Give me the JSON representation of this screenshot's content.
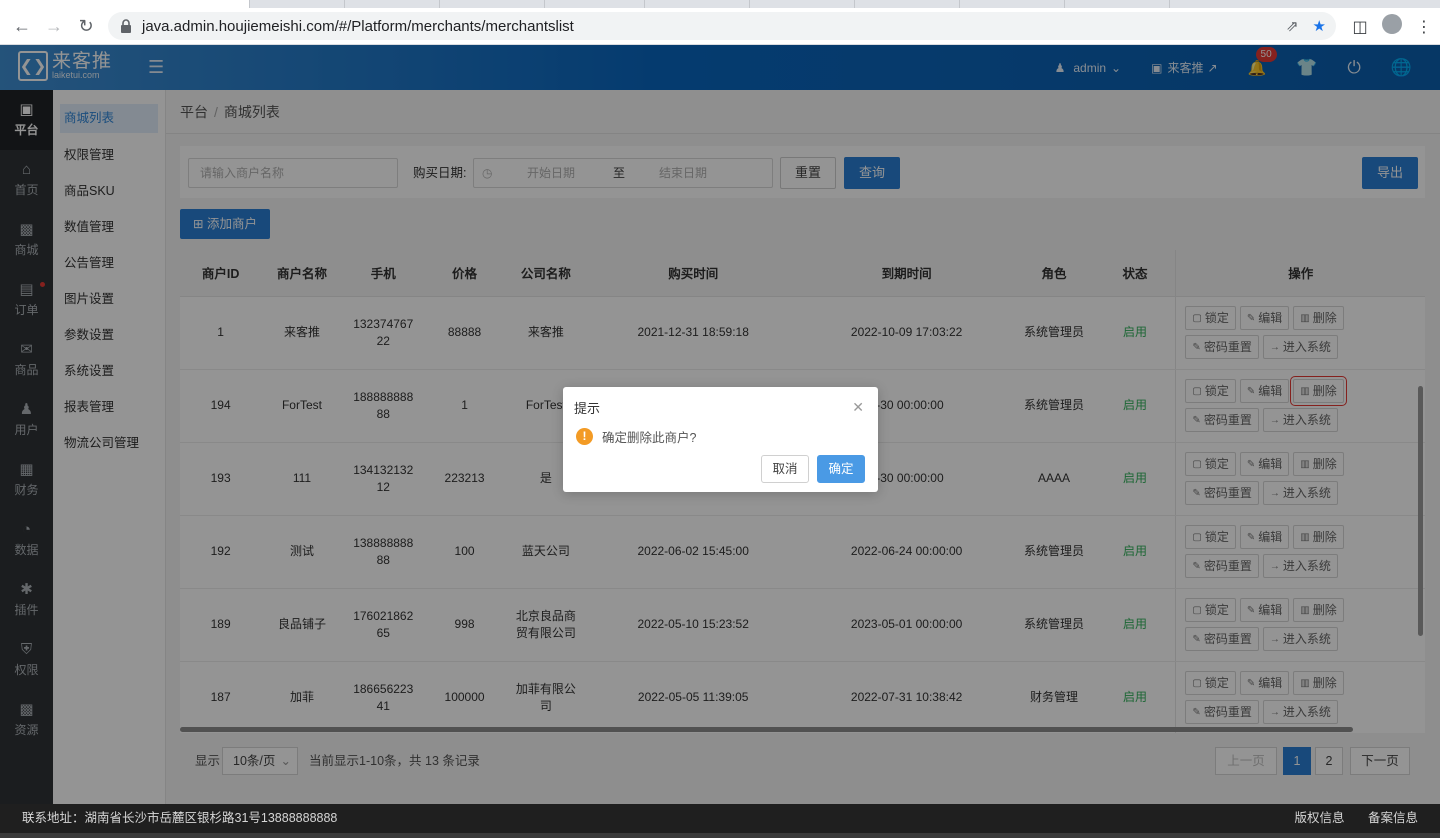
{
  "browser": {
    "url": "java.admin.houjiemeishi.com/#/Platform/merchants/merchantslist"
  },
  "header": {
    "logo_cn": "来客推",
    "logo_en": "laiketui.com",
    "user": "admin",
    "store": "来客推",
    "notification_count": "50"
  },
  "rail": {
    "items": [
      {
        "label": "平台",
        "icon": "platform-icon"
      },
      {
        "label": "首页",
        "icon": "home-icon"
      },
      {
        "label": "商城",
        "icon": "mall-icon"
      },
      {
        "label": "订单",
        "icon": "order-icon"
      },
      {
        "label": "商品",
        "icon": "goods-icon"
      },
      {
        "label": "用户",
        "icon": "user-icon"
      },
      {
        "label": "财务",
        "icon": "wallet-icon"
      },
      {
        "label": "数据",
        "icon": "pie-chart-icon"
      },
      {
        "label": "插件",
        "icon": "puzzle-icon"
      },
      {
        "label": "权限",
        "icon": "shield-icon"
      },
      {
        "label": "资源",
        "icon": "image-icon"
      }
    ]
  },
  "submenu": {
    "items": [
      "商城列表",
      "权限管理",
      "商品SKU",
      "数值管理",
      "公告管理",
      "图片设置",
      "参数设置",
      "系统设置",
      "报表管理",
      "物流公司管理"
    ]
  },
  "breadcrumb": {
    "root": "平台",
    "sep": "/",
    "current": "商城列表"
  },
  "filters": {
    "name_placeholder": "请输入商户名称",
    "date_label": "购买日期:",
    "start_placeholder": "开始日期",
    "to": "至",
    "end_placeholder": "结束日期",
    "reset": "重置",
    "query": "查询",
    "export": "导出"
  },
  "add_button": "添加商户",
  "table": {
    "headers": [
      "商户ID",
      "商户名称",
      "手机",
      "价格",
      "公司名称",
      "购买时间",
      "到期时间",
      "角色",
      "状态",
      "操作"
    ],
    "ops": {
      "lock": "锁定",
      "edit": "编辑",
      "delete": "删除",
      "reset_pwd": "密码重置",
      "enter": "进入系统"
    },
    "rows": [
      {
        "id": "1",
        "name": "来客推",
        "phone1": "132374767",
        "phone2": "22",
        "price": "88888",
        "company1": "来客推",
        "company2": "",
        "buy": "2021-12-31 18:59:18",
        "expire": "2022-10-09 17:03:22",
        "role": "系统管理员",
        "status": "启用"
      },
      {
        "id": "194",
        "name": "ForTest",
        "phone1": "188888888",
        "phone2": "88",
        "price": "1",
        "company1": "ForTest",
        "company2": "",
        "buy": "",
        "expire": "6-30 00:00:00",
        "role": "系统管理员",
        "status": "启用"
      },
      {
        "id": "193",
        "name": "111",
        "phone1": "134132132",
        "phone2": "12",
        "price": "223213",
        "company1": "是",
        "company2": "",
        "buy": "",
        "expire": "6-30 00:00:00",
        "role": "AAAA",
        "status": "启用"
      },
      {
        "id": "192",
        "name": "测试",
        "phone1": "138888888",
        "phone2": "88",
        "price": "100",
        "company1": "蓝天公司",
        "company2": "",
        "buy": "2022-06-02 15:45:00",
        "expire": "2022-06-24 00:00:00",
        "role": "系统管理员",
        "status": "启用"
      },
      {
        "id": "189",
        "name": "良品铺子",
        "phone1": "176021862",
        "phone2": "65",
        "price": "998",
        "company1": "北京良品商",
        "company2": "贸有限公司",
        "buy": "2022-05-10 15:23:52",
        "expire": "2023-05-01 00:00:00",
        "role": "系统管理员",
        "status": "启用"
      },
      {
        "id": "187",
        "name": "加菲",
        "phone1": "186656223",
        "phone2": "41",
        "price": "100000",
        "company1": "加菲有限公",
        "company2": "司",
        "buy": "2022-05-05 11:39:05",
        "expire": "2022-07-31 10:38:42",
        "role": "财务管理",
        "status": "启用"
      }
    ]
  },
  "pagination": {
    "show": "显示",
    "per_page": "10条/页",
    "summary": "当前显示1-10条，共 13 条记录",
    "prev": "上一页",
    "page1": "1",
    "page2": "2",
    "next": "下一页"
  },
  "footer": {
    "address": "联系地址：湖南省长沙市岳麓区银杉路31号13888888888",
    "copyright": "版权信息",
    "record": "备案信息"
  },
  "dialog": {
    "title": "提示",
    "message": "确定删除此商户?",
    "cancel": "取消",
    "confirm": "确定"
  },
  "colors": {
    "accent": "#2a7fd4",
    "status_green": "#33b15c",
    "warning": "#f39b25",
    "header_gradient_start": "#3f8fd3",
    "header_gradient_end": "#0c5fae"
  }
}
